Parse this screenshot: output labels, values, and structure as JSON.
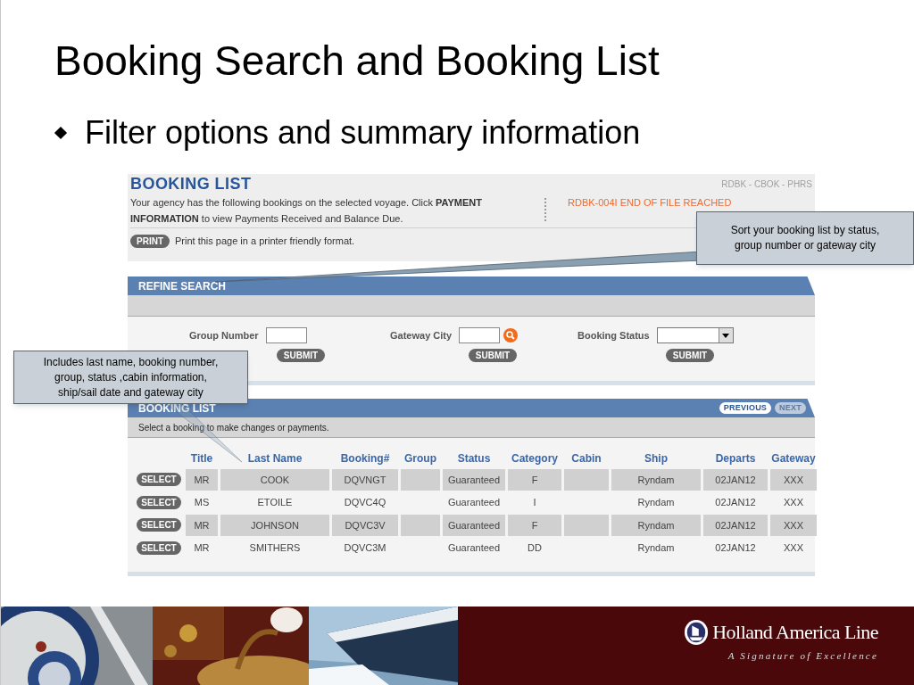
{
  "slide": {
    "title": "Booking Search and Booking List",
    "bullets": [
      "Filter options and summary information"
    ]
  },
  "page": {
    "header": {
      "title": "BOOKING LIST",
      "codes": "RDBK - CBOK - PHRS",
      "intro": "Your agency has the following bookings on the selected voyage. Click **PAYMENT INFORMATION** to view Payments Received and Balance Due.",
      "message": "RDBK-004I END OF FILE REACHED",
      "print_button": "PRINT",
      "print_note": "Print this page in a printer friendly format."
    },
    "refine_search": {
      "title": "REFINE SEARCH",
      "filters": [
        {
          "label": "Group Number",
          "kind": "text",
          "button": "SUBMIT"
        },
        {
          "label": "Gateway City",
          "kind": "lookup",
          "button": "SUBMIT"
        },
        {
          "label": "Booking Status",
          "kind": "select",
          "button": "SUBMIT"
        }
      ]
    },
    "booking_list": {
      "title": "BOOKING LIST",
      "hint": "Select a booking to make changes or payments.",
      "nav": [
        {
          "label": "PREVIOUS",
          "disabled": false
        },
        {
          "label": "NEXT",
          "disabled": true
        }
      ],
      "columns": [
        "Title",
        "Last Name",
        "Booking#",
        "Group",
        "Status",
        "Category",
        "Cabin",
        "Ship",
        "Departs",
        "Gateway"
      ],
      "rows": [
        {
          "button": "SELECT",
          "cells": [
            "MR",
            "COOK",
            "DQVNGT",
            "",
            "Guaranteed",
            "F",
            "",
            "Ryndam",
            "02JAN12",
            "XXX"
          ]
        },
        {
          "button": "SELECT",
          "cells": [
            "MS",
            "ETOILE",
            "DQVC4Q",
            "",
            "Guaranteed",
            "I",
            "",
            "Ryndam",
            "02JAN12",
            "XXX"
          ]
        },
        {
          "button": "SELECT",
          "cells": [
            "MR",
            "JOHNSON",
            "DQVC3V",
            "",
            "Guaranteed",
            "F",
            "",
            "Ryndam",
            "02JAN12",
            "XXX"
          ]
        },
        {
          "button": "SELECT",
          "cells": [
            "MR",
            "SMITHERS",
            "DQVC3M",
            "",
            "Guaranteed",
            "DD",
            "",
            "Ryndam",
            "02JAN12",
            "XXX"
          ]
        }
      ]
    }
  },
  "callouts": [
    {
      "text": "Sort your booking list by status, group number or gateway city"
    },
    {
      "text": "Includes last name, booking number, group, status ,cabin information, ship/sail date and gateway city"
    }
  ],
  "footer": {
    "brand": "Holland America Line",
    "tagline": "A Signature of Excellence"
  }
}
